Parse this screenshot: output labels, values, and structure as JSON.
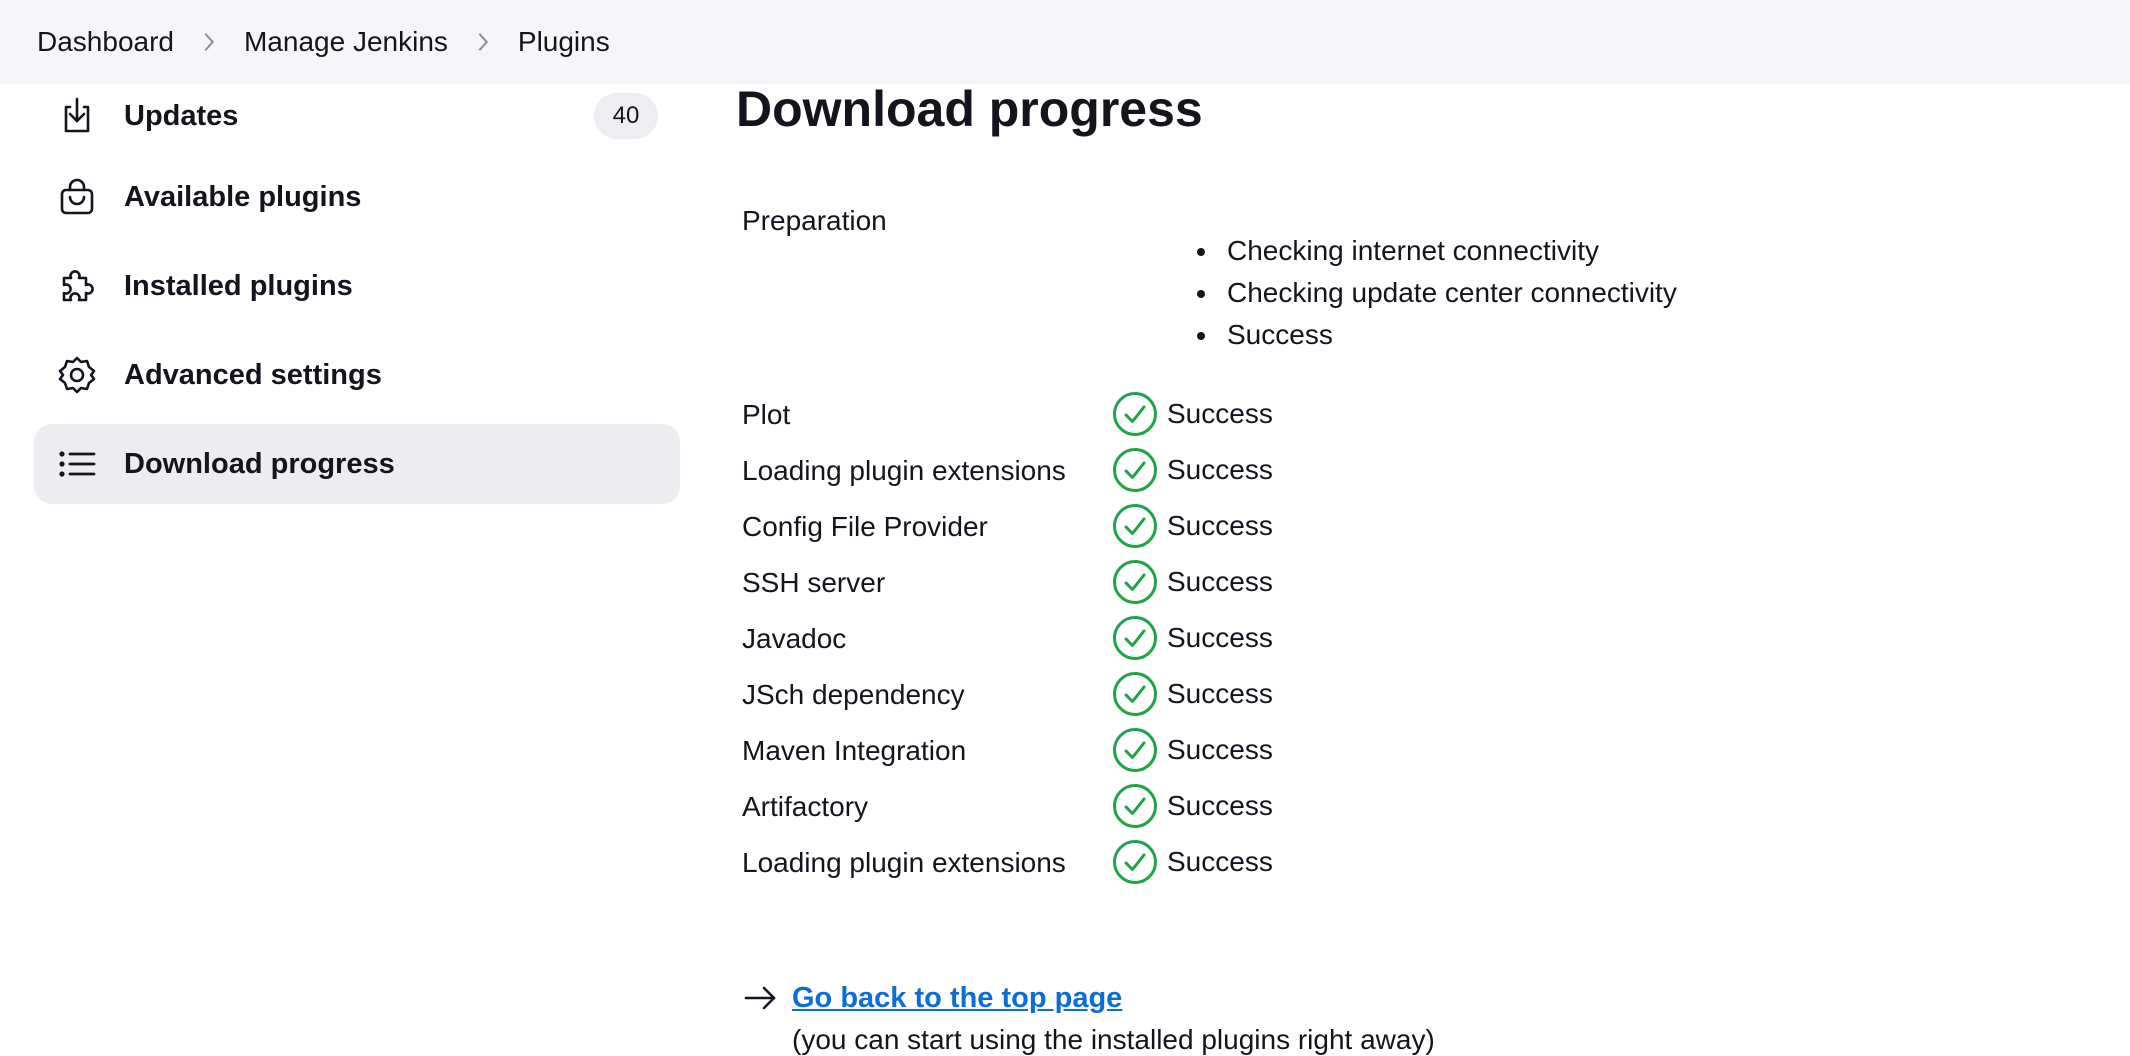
{
  "breadcrumb": {
    "items": [
      "Dashboard",
      "Manage Jenkins",
      "Plugins"
    ]
  },
  "sidebar": {
    "items": [
      {
        "label": "Updates",
        "icon": "download-icon",
        "badge": "40"
      },
      {
        "label": "Available plugins",
        "icon": "shopping-bag-icon"
      },
      {
        "label": "Installed plugins",
        "icon": "puzzle-icon"
      },
      {
        "label": "Advanced settings",
        "icon": "gear-icon"
      },
      {
        "label": "Download progress",
        "icon": "list-icon",
        "active": true
      }
    ]
  },
  "main": {
    "title": "Download progress",
    "preparation": {
      "label": "Preparation",
      "steps": [
        "Checking internet connectivity",
        "Checking update center connectivity",
        "Success"
      ]
    },
    "plugins": [
      {
        "name": "Plot",
        "status": "Success"
      },
      {
        "name": "Loading plugin extensions",
        "status": "Success"
      },
      {
        "name": "Config File Provider",
        "status": "Success"
      },
      {
        "name": "SSH server",
        "status": "Success"
      },
      {
        "name": "Javadoc",
        "status": "Success"
      },
      {
        "name": "JSch dependency",
        "status": "Success"
      },
      {
        "name": "Maven Integration",
        "status": "Success"
      },
      {
        "name": "Artifactory",
        "status": "Success"
      },
      {
        "name": "Loading plugin extensions",
        "status": "Success"
      }
    ],
    "back_link": "Go back to the top page",
    "back_note": "(you can start using the installed plugins right away)"
  },
  "colors": {
    "success": "#1ea446",
    "link": "#0b6dd8",
    "active_bg": "#ececf1"
  }
}
